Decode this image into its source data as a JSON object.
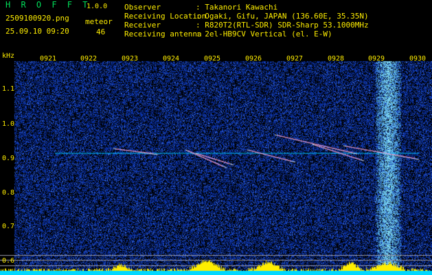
{
  "header": {
    "title": "H R O F F T",
    "version": "1.0.0",
    "filename": "2509100920.png",
    "datetime": "25.09.10 09:20",
    "meteor_label": "meteor",
    "meteor_count": "46"
  },
  "station": {
    "labels": "Observer\nReceiving Location\nReceiver\nReceiving antenna",
    "values": ": Takanori Kawachi\n: Ogaki, Gifu, JAPAN (136.60E, 35.35N)\n: R820T2(RTL-SDR) SDR-Sharp 53.1000MHz\n: 2el-HB9CV Vertical (el. E-W)"
  },
  "colors": {
    "background": "#000000",
    "label_green": "#00e05a",
    "label_yellow": "#ffee00",
    "noise_blue": "#1a2a9a",
    "echo_trace": "#00c8ff",
    "bar_yellow": "#ffee00",
    "bar_cyan": "#00d8ff",
    "gridline": "#9a9aa8"
  },
  "axes": {
    "y_unit": "kHz",
    "y_ticks": [
      "1.1",
      "1.0",
      "0.9",
      "0.8",
      "0.7",
      "0.6"
    ],
    "x_ticks": [
      "0921",
      "0922",
      "0923",
      "0924",
      "0925",
      "0926",
      "0927",
      "0928",
      "0929",
      "0930"
    ]
  }
}
